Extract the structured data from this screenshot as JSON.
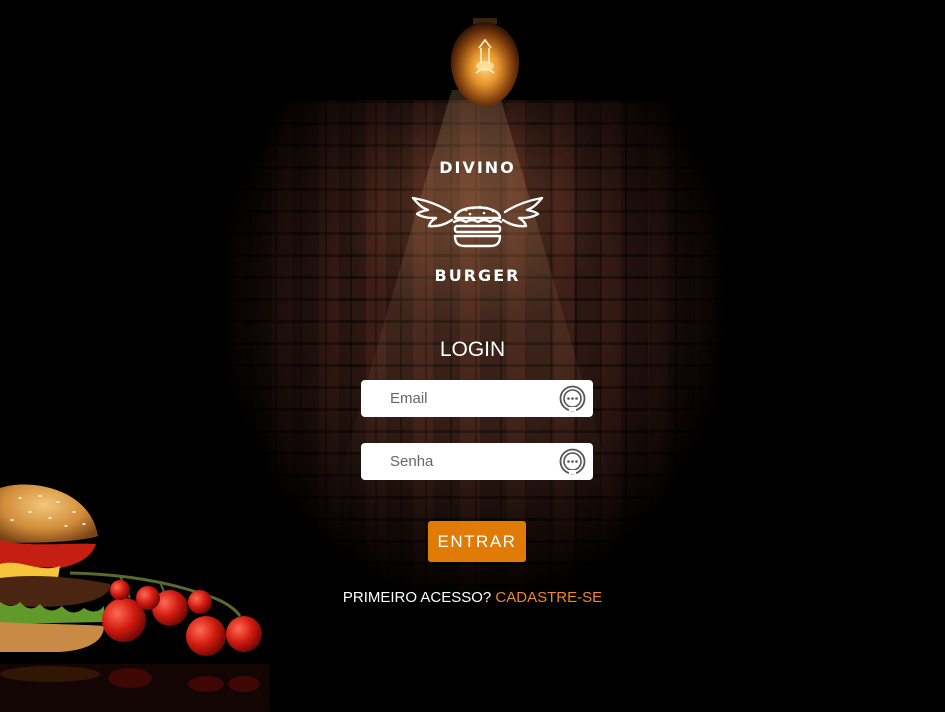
{
  "brand": {
    "name_top": "DIVINO",
    "name_bottom": "BURGER"
  },
  "login": {
    "title": "LOGIN",
    "email_placeholder": "Email",
    "password_placeholder": "Senha",
    "submit_label": "ENTRAR",
    "first_access_text": "PRIMEIRO ACESSO?",
    "signup_link": "CADASTRE-SE"
  },
  "icons": {
    "email_field": "password-manager-icon",
    "password_field": "password-manager-icon"
  },
  "colors": {
    "accent": "#e07b06",
    "link": "#f08a1a",
    "background": "#000000"
  }
}
